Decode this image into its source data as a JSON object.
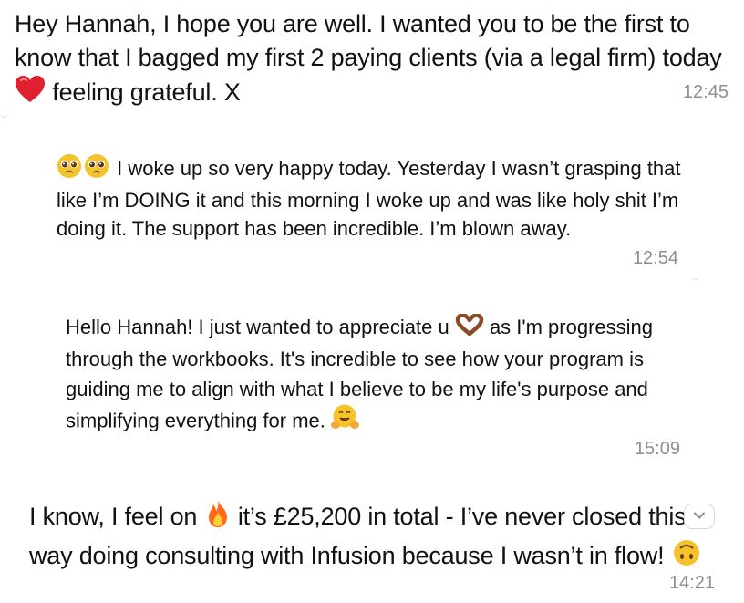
{
  "messages": [
    {
      "text_a": "Hey Hannah, I hope you are well. I wanted you to be the first to know that I bagged my first 2  paying clients (via a legal firm) today ",
      "text_b": " feeling grateful. X",
      "time": "12:45",
      "emoji": "red-heart"
    },
    {
      "text": " I woke up so very happy today. Yesterday I wasn’t grasping that like I’m DOING it and this morning I woke up and was like holy shit I’m doing it. The support has been incredible. I’m blown away.",
      "time": "12:54",
      "emoji": "pleading-face"
    },
    {
      "text_a": "Hello Hannah! I just wanted to appreciate u ",
      "text_b": " as I'm progressing through the workbooks. It's incredible to see how your program is guiding me to align with what I believe to be my life's purpose and simplifying everything for me. ",
      "time": "15:09",
      "emoji_a": "heart-hands",
      "emoji_b": "hugging-face"
    },
    {
      "text_a": "I know, I feel on ",
      "text_b": " it’s £25,200 in total - I’ve never closed this way doing consulting with Infusion because I wasn’t in flow! ",
      "time": "14:21",
      "emoji_a": "fire",
      "emoji_b": "upside-down-face"
    }
  ],
  "colors": {
    "text": "#111111",
    "time": "#8e8e93",
    "heart": "#e0202e",
    "emoji_yellow": "#f6c22a",
    "fire": "#ff6b1a"
  },
  "controls": {
    "chevron_icon": "chevron-down-icon"
  }
}
